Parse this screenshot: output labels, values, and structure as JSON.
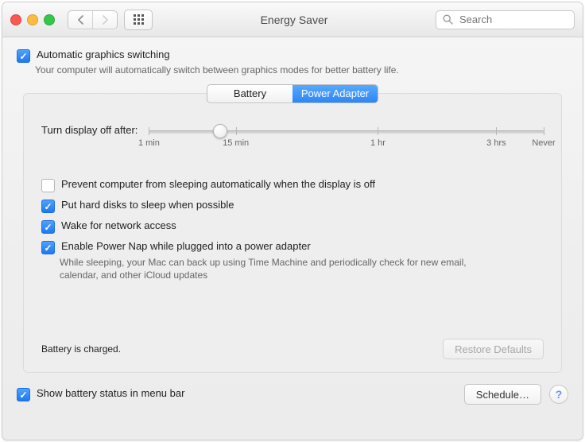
{
  "window": {
    "title": "Energy Saver"
  },
  "search": {
    "placeholder": "Search"
  },
  "auto_graphics": {
    "checked": true,
    "label": "Automatic graphics switching",
    "hint": "Your computer will automatically switch between graphics modes for better battery life."
  },
  "tabs": {
    "battery": "Battery",
    "power_adapter": "Power Adapter",
    "active": "power_adapter"
  },
  "slider": {
    "label": "Turn display off after:",
    "ticks": [
      {
        "pos": 0,
        "label": "1 min"
      },
      {
        "pos": 22,
        "label": "15 min"
      },
      {
        "pos": 58,
        "label": "1 hr"
      },
      {
        "pos": 88,
        "label": "3 hrs"
      },
      {
        "pos": 100,
        "label": "Never"
      }
    ],
    "value_pos": 18
  },
  "options": {
    "prevent_sleep": {
      "checked": false,
      "label": "Prevent computer from sleeping automatically when the display is off"
    },
    "hd_sleep": {
      "checked": true,
      "label": "Put hard disks to sleep when possible"
    },
    "wake_net": {
      "checked": true,
      "label": "Wake for network access"
    },
    "power_nap": {
      "checked": true,
      "label": "Enable Power Nap while plugged into a power adapter",
      "hint": "While sleeping, your Mac can back up using Time Machine and periodically check for new email, calendar, and other iCloud updates"
    }
  },
  "status": {
    "battery": "Battery is charged."
  },
  "buttons": {
    "restore": "Restore Defaults",
    "schedule": "Schedule…"
  },
  "menu_bar": {
    "checked": true,
    "label": "Show battery status in menu bar"
  }
}
